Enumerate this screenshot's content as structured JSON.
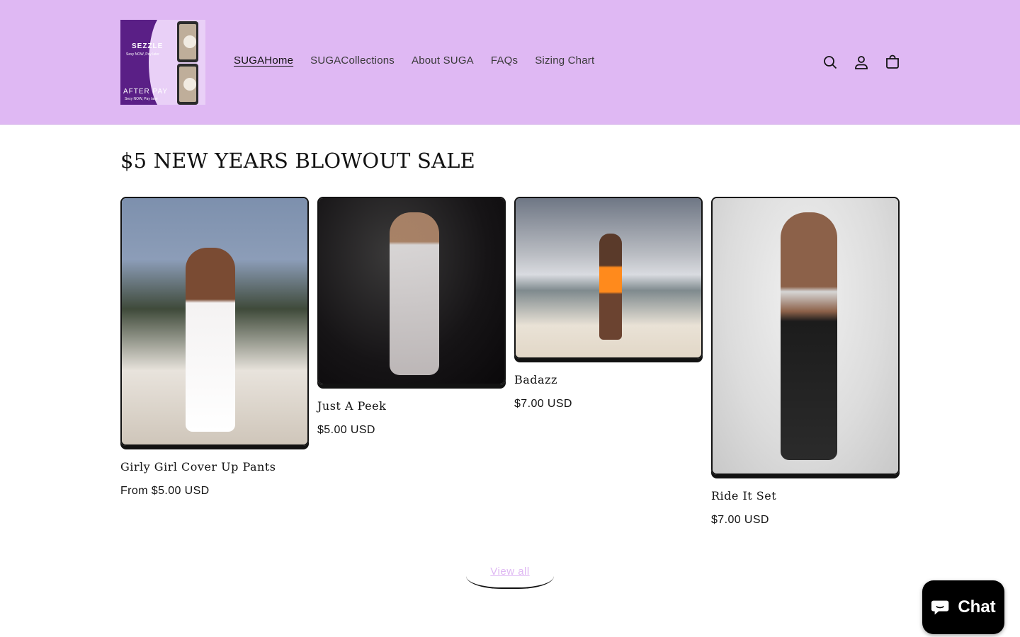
{
  "header": {
    "logo": {
      "line1": "SEZZLE",
      "line1_sub": "Sexy NOW, Pay later",
      "line2": "AFTER PAY",
      "line2_sub": "Sexy NOW, Pay later"
    },
    "nav": [
      {
        "label": "SUGAHome",
        "active": true
      },
      {
        "label": "SUGACollections",
        "active": false
      },
      {
        "label": "About SUGA",
        "active": false
      },
      {
        "label": "FAQs",
        "active": false
      },
      {
        "label": "Sizing Chart",
        "active": false
      }
    ],
    "icons": [
      "search-icon",
      "account-icon",
      "cart-icon"
    ],
    "background_color": "#dfb8f3"
  },
  "section": {
    "title": "$5 NEW YEARS BLOWOUT SALE",
    "products": [
      {
        "name": "Girly Girl Cover Up Pants",
        "price": "From $5.00 USD"
      },
      {
        "name": "Just A Peek",
        "price": "$5.00 USD"
      },
      {
        "name": "Badazz",
        "price": "$7.00 USD"
      },
      {
        "name": "Ride It Set",
        "price": "$7.00 USD"
      }
    ],
    "view_all": "View all"
  },
  "chat_widget": {
    "label": "Chat"
  }
}
